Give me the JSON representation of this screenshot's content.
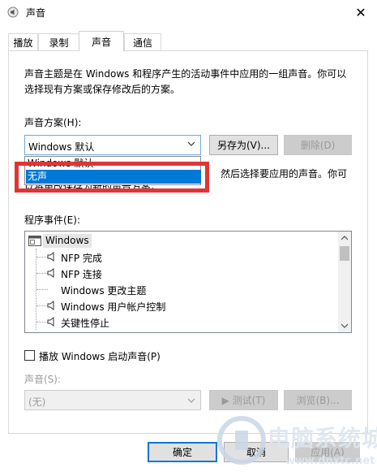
{
  "window": {
    "title": "声音",
    "close_symbol": "✕"
  },
  "tabs": [
    {
      "label": "播放"
    },
    {
      "label": "录制"
    },
    {
      "label": "声音"
    },
    {
      "label": "通信"
    }
  ],
  "description": {
    "line1": "声音主题是在 Windows 和程序产生的活动事件中应用的一组声音。你可以",
    "line2": "选择现有方案或保存修改后的方案。"
  },
  "scheme": {
    "label": "声音方案(H):",
    "selected": "Windows 默认",
    "options": [
      "Windows 默认",
      "无声"
    ],
    "save_as_label": "另存为(V)...",
    "delete_label": "删除(D)"
  },
  "hint": {
    "line1_suffix": "然后选择要应用的声音。你可",
    "line2": "以将更改保存为新的声音方案。"
  },
  "events": {
    "label": "程序事件(E):",
    "group": "Windows",
    "items": [
      {
        "label": "NFP 完成",
        "has_sound": true
      },
      {
        "label": "NFP 连接",
        "has_sound": true
      },
      {
        "label": "Windows 更改主题",
        "has_sound": false
      },
      {
        "label": "Windows 用户帐户控制",
        "has_sound": true
      },
      {
        "label": "关键性停止",
        "has_sound": true
      }
    ]
  },
  "startup": {
    "checkbox_label": "播放 Windows 启动声音(P)",
    "checked": false
  },
  "sounds": {
    "label": "声音(S):",
    "selected": "(无)",
    "test_label": "▶ 测试(T)",
    "browse_label": "浏览(B)..."
  },
  "footer": {
    "ok_label": "确定",
    "cancel_label": "取消",
    "apply_label": "应用(A)"
  },
  "watermark": {
    "text": "电脑系统城",
    "url": "www.dnxtc.net"
  },
  "colors": {
    "accent": "#0078d7",
    "highlight_border": "#e03535"
  }
}
